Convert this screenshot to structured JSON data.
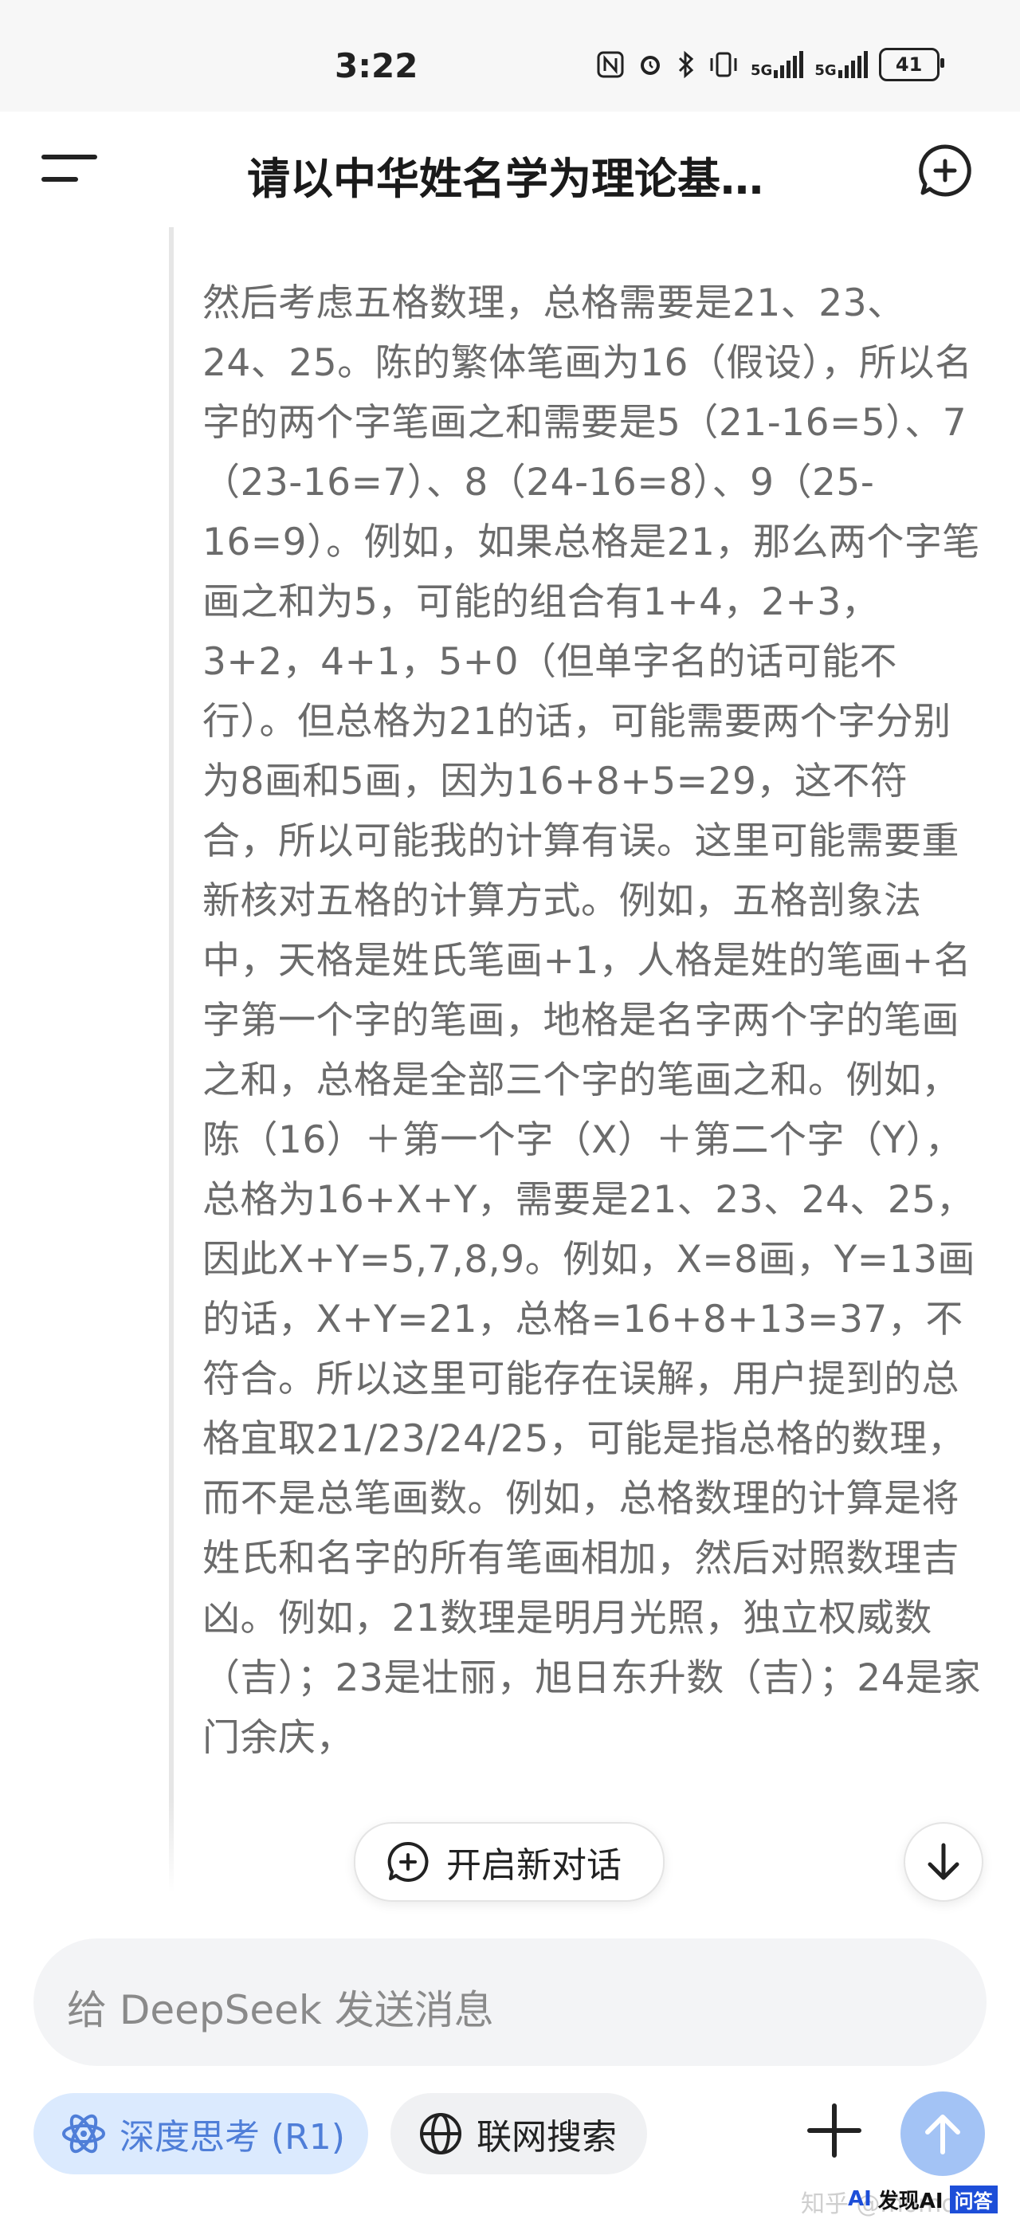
{
  "status_bar": {
    "time": "3:22",
    "network_1": "5G",
    "network_2": "5G",
    "battery": "41",
    "icons": [
      "nfc-icon",
      "alarm-icon",
      "bluetooth-icon",
      "vibrate-icon",
      "signal-icon",
      "signal-icon",
      "battery-icon"
    ]
  },
  "header": {
    "title": "请以中华姓名学为理论基…",
    "menu_icon": "menu-icon",
    "new_chat_icon": "new-chat-icon"
  },
  "thinking": {
    "text": "然后考虑五格数理，总格需要是21、23、24、25。陈的繁体笔画为16（假设），所以名字的两个字笔画之和需要是5（21-16=5）、7（23-16=7）、8（24-16=8）、9（25-16=9）。例如，如果总格是21，那么两个字笔画之和为5，可能的组合有1+4，2+3，3+2，4+1，5+0（但单字名的话可能不行）。但总格为21的话，可能需要两个字分别为8画和5画，因为16+8+5=29，这不符合，所以可能我的计算有误。这里可能需要重新核对五格的计算方式。例如，五格剖象法中，天格是姓氏笔画+1，人格是姓的笔画+名字第一个字的笔画，地格是名字两个字的笔画之和，总格是全部三个字的笔画之和。例如，陈（16）＋第一个字（X）＋第二个字（Y），总格为16+X+Y，需要是21、23、24、25，因此X+Y=5,7,8,9。例如，X=8画，Y=13画的话，X+Y=21，总格=16+8+13=37，不符合。所以这里可能存在误解，用户提到的总格宜取21/23/24/25，可能是指总格的数理，而不是总笔画数。例如，总格数理的计算是将姓氏和名字的所有笔画相加，然后对照数理吉凶。例如，21数理是明月光照，独立权威数（吉）；23是壮丽，旭日东升数（吉）；24是家门余庆，"
  },
  "floating": {
    "new_chat_label": "开启新对话",
    "scroll_down_icon": "arrow-down-icon"
  },
  "composer": {
    "placeholder": "给 DeepSeek 发送消息",
    "deep_think_label": "深度思考 (R1)",
    "web_search_label": "联网搜索",
    "attach_icon": "plus-icon",
    "send_icon": "arrow-up-icon"
  },
  "watermark": {
    "zhihu": "知乎 @momo",
    "brand_ai": "AI",
    "brand_text": "发现AI",
    "brand_ask": "问答"
  },
  "colors": {
    "thinking_text": "#6b6b6b",
    "deep_think_bg": "#dbeafe",
    "deep_think_fg": "#4f7ed8",
    "send_bg": "#a3c3f5"
  }
}
